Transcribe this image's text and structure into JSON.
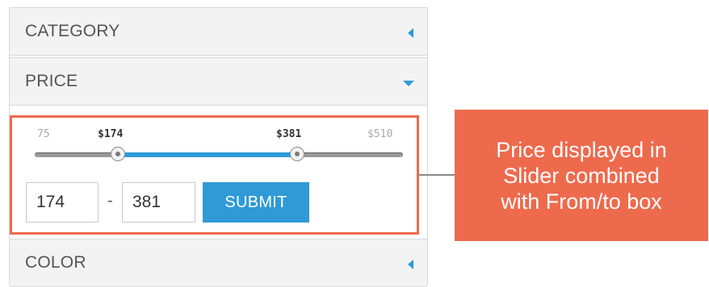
{
  "filters": {
    "category": {
      "label": "CATEGORY",
      "state": "collapsed"
    },
    "price": {
      "label": "PRICE",
      "state": "expanded"
    },
    "color": {
      "label": "COLOR",
      "state": "collapsed"
    }
  },
  "price_slider": {
    "min_label": "75",
    "max_label": "$510",
    "from_label": "$174",
    "to_label": "$381",
    "min": 75,
    "max": 510,
    "from": 174,
    "to": 381,
    "accent_color": "#2f9ad6"
  },
  "price_inputs": {
    "from_value": "174",
    "separator": "-",
    "to_value": "381",
    "submit_label": "SUBMIT"
  },
  "callout": {
    "line1": "Price displayed in",
    "line2": "Slider combined",
    "line3": "with From/to box",
    "color": "#ee6a4d"
  },
  "icons": {
    "collapsed": "caret-left-icon",
    "expanded": "caret-down-icon"
  }
}
